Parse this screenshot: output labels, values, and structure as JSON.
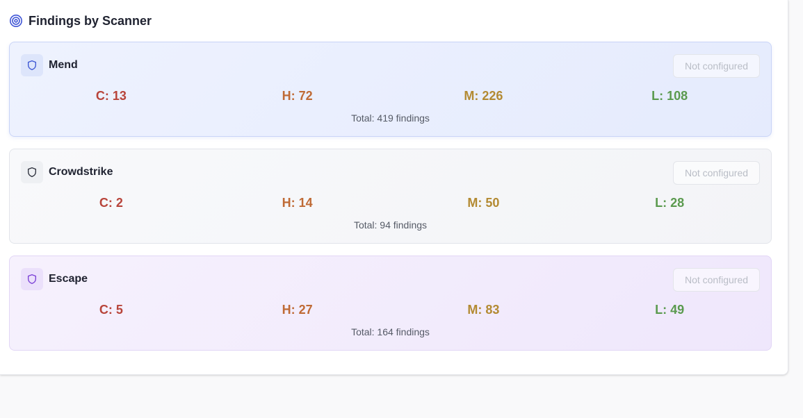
{
  "section": {
    "title": "Findings by Scanner",
    "icon": "target-icon"
  },
  "colors": {
    "critical": "#b8443a",
    "high": "#bf6a35",
    "medium": "#b38a32",
    "low": "#5a9a4e"
  },
  "scanners": [
    {
      "name": "Mend",
      "icon": "shield-icon",
      "status": "Not configured",
      "critical": "C: 13",
      "high": "H: 72",
      "medium": "M: 226",
      "low": "L: 108",
      "total": "Total: 419 findings"
    },
    {
      "name": "Crowdstrike",
      "icon": "shield-icon",
      "status": "Not configured",
      "critical": "C: 2",
      "high": "H: 14",
      "medium": "M: 50",
      "low": "L: 28",
      "total": "Total: 94 findings"
    },
    {
      "name": "Escape",
      "icon": "shield-icon",
      "status": "Not configured",
      "critical": "C: 5",
      "high": "H: 27",
      "medium": "M: 83",
      "low": "L: 49",
      "total": "Total: 164 findings"
    }
  ]
}
